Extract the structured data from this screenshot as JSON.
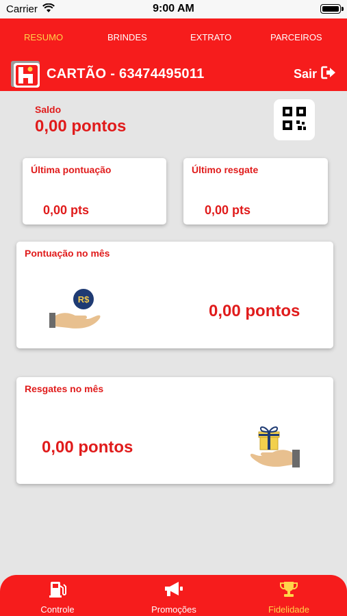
{
  "status_bar": {
    "carrier": "Carrier",
    "time": "9:00 AM"
  },
  "tabs": [
    {
      "label": "RESUMO",
      "active": true
    },
    {
      "label": "BRINDES",
      "active": false
    },
    {
      "label": "EXTRATO",
      "active": false
    },
    {
      "label": "PARCEIROS",
      "active": false
    }
  ],
  "header": {
    "card_title": "CARTÃO - 63474495011",
    "logout_label": "Sair"
  },
  "balance": {
    "label": "Saldo",
    "value": "0,00 pontos"
  },
  "last_points": {
    "label": "Última pontuação",
    "value": "0,00 pts"
  },
  "last_redeem": {
    "label": "Último resgate",
    "value": "0,00 pts"
  },
  "month_points": {
    "label": "Pontuação no mês",
    "value": "0,00 pontos",
    "coin_text": "R$"
  },
  "month_redeems": {
    "label": "Resgates no mês",
    "value": "0,00 pontos"
  },
  "bottom_nav": [
    {
      "label": "Controle",
      "icon": "fuel-pump-icon",
      "active": false
    },
    {
      "label": "Promoções",
      "icon": "megaphone-icon",
      "active": false
    },
    {
      "label": "Fidelidade",
      "icon": "trophy-icon",
      "active": true
    }
  ],
  "colors": {
    "brand_red": "#f61c1c",
    "text_red": "#e01b1b",
    "active_yellow": "#ffd54a",
    "background": "#e5e5e5"
  }
}
